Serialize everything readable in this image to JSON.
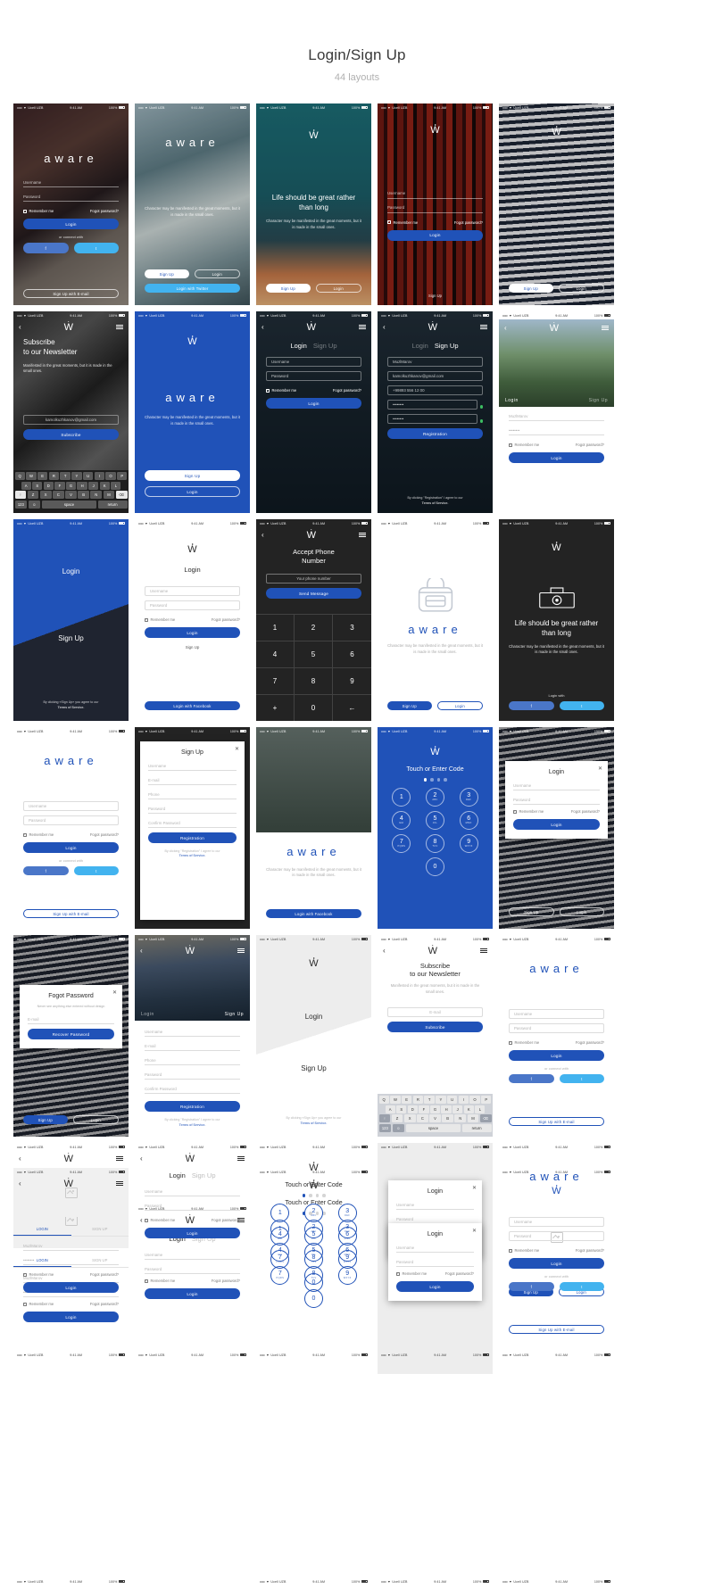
{
  "header": {
    "title": "Login/Sign Up",
    "subtitle": "44 layouts"
  },
  "brand": {
    "wordmark": "aware",
    "mark": "W"
  },
  "status": {
    "carrier": "Ucell UZB",
    "time": "9:41 AM",
    "battery": "100%",
    "signal": "•••••",
    "wifi": "▼"
  },
  "common": {
    "username": "Username",
    "password": "Password",
    "email": "E-mail",
    "phone": "Phone",
    "confirm_password": "Confirm Password",
    "remember": "Remember me",
    "forgot": "Fogot password?",
    "login": "Login",
    "signup": "Sign Up",
    "registration": "Registration",
    "subscribe": "Subscribe",
    "or_connect": "or connect with",
    "login_with": "Login with",
    "facebook": "f",
    "twitter": "t",
    "signup_email": "Sign Up with E-mail",
    "login_facebook": "Login with Facebook",
    "login_twitter": "Login with Twitter",
    "recover": "Recover Password",
    "send_message": "Send Message",
    "your_phone": "Your phone number",
    "tagline": "Character may be manifested in the great moments, but it is made in the small ones.",
    "tagline_short": "Manifested in the great moments, but it is made in the small ones.",
    "headline_life": "Life should be great rather than long",
    "headline_subscribe_1": "Subscribe",
    "headline_subscribe_2": "to our Newsletter",
    "headline_touch": "Touch or Enter Code",
    "headline_accept_1": "Accept Phone",
    "headline_accept_2": "Number",
    "headline_forgot": "Fogot Password",
    "terms_login": "By clicking «Sign Up» you agree to our",
    "terms_reg": "By clicking \"Registration\" I agree to our",
    "terms_link": "Terms of Service.",
    "forgot_note": "Never see anything else entered without design",
    "user_email": "kamolkuzhkanov@gmail.com",
    "user_name": "MuzlMarov",
    "user_pass": "••••••••",
    "user_phone": "+99893 556 12 00",
    "tab_login": "LOGIN",
    "tab_signup": "SIGN UP"
  },
  "keyboard": {
    "row1": [
      "Q",
      "W",
      "E",
      "R",
      "T",
      "Y",
      "U",
      "I",
      "O",
      "P"
    ],
    "row2": [
      "A",
      "S",
      "D",
      "F",
      "G",
      "H",
      "J",
      "K",
      "L"
    ],
    "row3": [
      "Z",
      "X",
      "C",
      "V",
      "B",
      "N",
      "M"
    ],
    "shift": "↑",
    "backspace": "⌫",
    "numkey": "123",
    "emoji": "☺",
    "space": "space",
    "return": "return"
  },
  "keypad": {
    "digits": [
      "1",
      "2",
      "3",
      "4",
      "5",
      "6",
      "7",
      "8",
      "9"
    ],
    "plus": "+",
    "zero": "0",
    "back": "←",
    "letters": [
      "",
      "ABC",
      "DEF",
      "GHI",
      "JKL",
      "MNO",
      "PQRS",
      "TUV",
      "WXYZ"
    ]
  },
  "colors": {
    "accent": "#2052b8",
    "facebook": "#4a76c8",
    "twitter": "#42b3ef",
    "dark": "#232323",
    "green": "#3dbd62"
  }
}
